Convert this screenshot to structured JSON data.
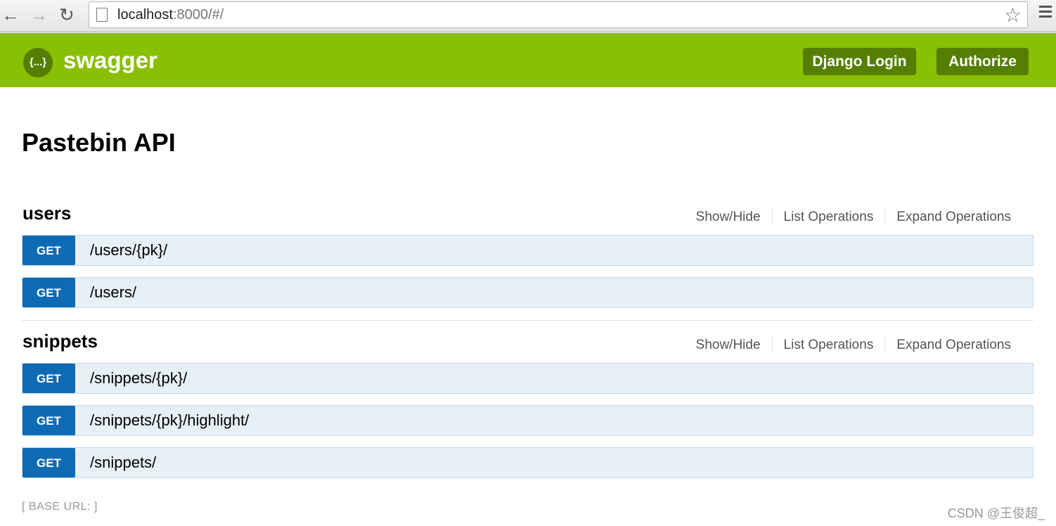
{
  "browser": {
    "url_host": "localhost",
    "url_rest": ":8000/#/"
  },
  "header": {
    "brand": "swagger",
    "logo_glyph": "{...}",
    "buttons": [
      "Django Login",
      "Authorize"
    ],
    "color": "#89bf04"
  },
  "title": "Pastebin API",
  "links": [
    "Show/Hide",
    "List Operations",
    "Expand Operations"
  ],
  "sections": [
    {
      "name": "users",
      "ops": [
        {
          "method": "GET",
          "path": "/users/{pk}/"
        },
        {
          "method": "GET",
          "path": "/users/"
        }
      ]
    },
    {
      "name": "snippets",
      "ops": [
        {
          "method": "GET",
          "path": "/snippets/{pk}/"
        },
        {
          "method": "GET",
          "path": "/snippets/{pk}/highlight/"
        },
        {
          "method": "GET",
          "path": "/snippets/"
        }
      ]
    }
  ],
  "base_url": "[ BASE URL: ]",
  "watermark": "CSDN @王俊超_"
}
